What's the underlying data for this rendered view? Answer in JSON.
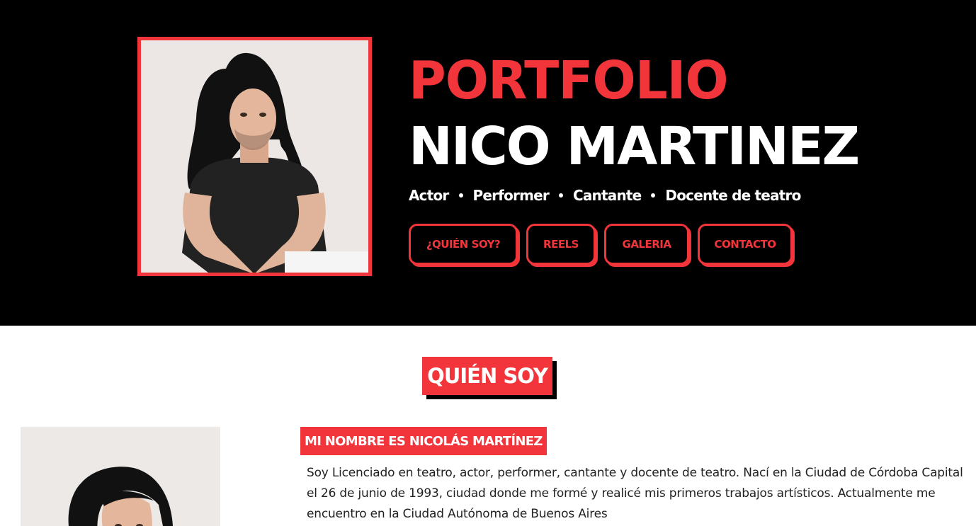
{
  "hero": {
    "title": "PORTFOLIO",
    "name": "NICO MARTINEZ",
    "roles": [
      "Actor",
      "Performer",
      "Cantante",
      "Docente de teatro"
    ],
    "photo_alt": "portrait-photo"
  },
  "nav": {
    "items": [
      {
        "label": "¿QUIÉN SOY?"
      },
      {
        "label": "REELS"
      },
      {
        "label": "GALERIA"
      },
      {
        "label": "CONTACTO"
      }
    ]
  },
  "about": {
    "section_title": "QUIÉN SOY",
    "subheading": "MI NOMBRE ES NICOLÁS MARTÍNEZ",
    "bio": "Soy Licenciado en teatro, actor, performer, cantante y docente de teatro. Nací en la Ciudad de Córdoba Capital el 26 de junio de 1993, ciudad donde me formé y realicé mis primeros trabajos artísticos. Actualmente me encuentro en la Ciudad Autónoma de Buenos Aires"
  },
  "colors": {
    "accent": "#f2353a",
    "hero_bg": "#000000",
    "page_bg": "#ffffff"
  }
}
